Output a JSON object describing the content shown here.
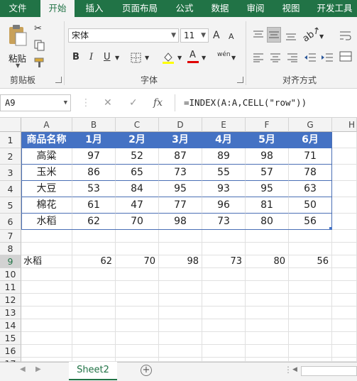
{
  "ribbon_tabs": [
    "文件",
    "开始",
    "插入",
    "页面布局",
    "公式",
    "数据",
    "审阅",
    "视图",
    "开发工具"
  ],
  "active_tab": "开始",
  "clipboard": {
    "paste_label": "粘贴",
    "group_label": "剪贴板"
  },
  "font": {
    "name": "宋体",
    "size": "11",
    "group_label": "字体",
    "bold": "B",
    "italic": "I",
    "underline": "U",
    "grow": "A",
    "shrink": "A",
    "phonetic": "wén"
  },
  "alignment": {
    "group_label": "对齐方式"
  },
  "name_box": "A9",
  "formula": "=INDEX(A:A,CELL(\"row\"))",
  "columns": [
    "A",
    "B",
    "C",
    "D",
    "E",
    "F",
    "G",
    "H"
  ],
  "rows": [
    "1",
    "2",
    "3",
    "4",
    "5",
    "6",
    "7",
    "8",
    "9",
    "10",
    "11",
    "12",
    "13",
    "14",
    "15",
    "16",
    "17"
  ],
  "table": {
    "header": [
      "商品名称",
      "1月",
      "2月",
      "3月",
      "4月",
      "5月",
      "6月"
    ],
    "rows": [
      [
        "高粱",
        "97",
        "52",
        "87",
        "89",
        "98",
        "71"
      ],
      [
        "玉米",
        "86",
        "65",
        "73",
        "55",
        "57",
        "78"
      ],
      [
        "大豆",
        "53",
        "84",
        "95",
        "93",
        "95",
        "63"
      ],
      [
        "棉花",
        "61",
        "47",
        "77",
        "96",
        "81",
        "50"
      ],
      [
        "水稻",
        "62",
        "70",
        "98",
        "73",
        "80",
        "56"
      ]
    ]
  },
  "row9": [
    "水稻",
    "62",
    "70",
    "98",
    "73",
    "80",
    "56"
  ],
  "sheet_tab": "Sheet2",
  "colors": {
    "accent": "#217346",
    "table_header": "#4472c4"
  }
}
